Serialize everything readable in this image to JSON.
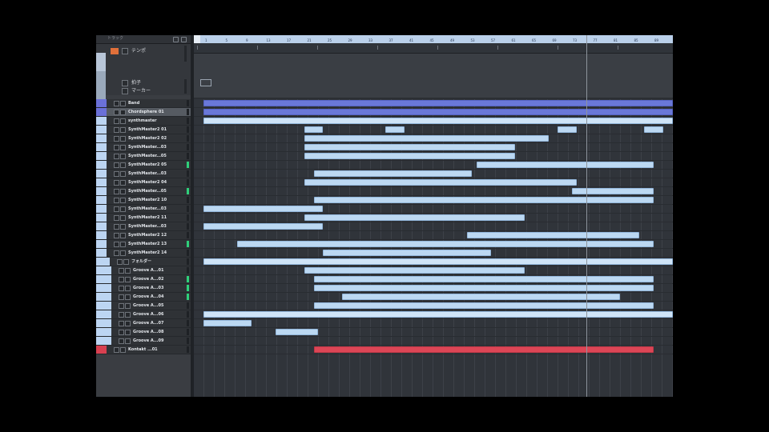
{
  "app": {
    "header_label": "トラック",
    "globals": [
      {
        "label": "テンポ"
      },
      {
        "label": "拍子"
      },
      {
        "label": "マーカー"
      }
    ]
  },
  "ruler": {
    "ticks": [
      "1",
      "5",
      "9",
      "13",
      "17",
      "21",
      "25",
      "29",
      "33",
      "37",
      "41",
      "45",
      "49",
      "53",
      "57",
      "61",
      "65",
      "69",
      "73",
      "77",
      "81",
      "85",
      "89",
      "93"
    ]
  },
  "tracks": [
    {
      "name": "Band",
      "color": "purple",
      "meter": false
    },
    {
      "name": "Chordsphere 01",
      "color": "purple",
      "meter": false,
      "selected": true
    },
    {
      "name": "synthmaster",
      "color": "lightb",
      "meter": false
    },
    {
      "name": "SynthMaster2 01",
      "color": "lightb",
      "meter": false
    },
    {
      "name": "SynthMaster2 02",
      "color": "lightb",
      "meter": false
    },
    {
      "name": "SynthMaster...03",
      "color": "lightb",
      "meter": false
    },
    {
      "name": "SynthMaster...05",
      "color": "lightb",
      "meter": false
    },
    {
      "name": "SynthMaster2 05",
      "color": "lightb",
      "meter": true
    },
    {
      "name": "SynthMaster...03",
      "color": "lightb",
      "meter": false
    },
    {
      "name": "SynthMaster2 04",
      "color": "lightb",
      "meter": false
    },
    {
      "name": "SynthMaster...05",
      "color": "lightb",
      "meter": true
    },
    {
      "name": "SynthMaster2 10",
      "color": "lightb",
      "meter": false
    },
    {
      "name": "SynthMaster...03",
      "color": "lightb",
      "meter": false
    },
    {
      "name": "SynthMaster2 11",
      "color": "lightb",
      "meter": false
    },
    {
      "name": "SynthMaster...03",
      "color": "lightb",
      "meter": false
    },
    {
      "name": "SynthMaster2 12",
      "color": "lightb",
      "meter": false
    },
    {
      "name": "SynthMaster2 13",
      "color": "lightb",
      "meter": true
    },
    {
      "name": "SynthMaster2 14",
      "color": "lightb",
      "meter": false
    },
    {
      "name": "フォルダー",
      "color": "lightb",
      "meter": false
    },
    {
      "name": "Groove A...01",
      "color": "lightb",
      "meter": false
    },
    {
      "name": "Groove A...02",
      "color": "lightb",
      "meter": true
    },
    {
      "name": "Groove A...03",
      "color": "lightb",
      "meter": true
    },
    {
      "name": "Groove A...04",
      "color": "lightb",
      "meter": true
    },
    {
      "name": "Groove A...05",
      "color": "lightb",
      "meter": false
    },
    {
      "name": "Groove A...06",
      "color": "lightb",
      "meter": false
    },
    {
      "name": "Groove A...07",
      "color": "lightb",
      "meter": false
    },
    {
      "name": "Groove A...08",
      "color": "lightb",
      "meter": false
    },
    {
      "name": "Groove A...09",
      "color": "lightb",
      "meter": false
    },
    {
      "name": "Kontakt ...01",
      "color": "red",
      "meter": false
    }
  ],
  "events": [
    {
      "row": 0,
      "from": 0.02,
      "to": 1.0,
      "style": "dark"
    },
    {
      "row": 1,
      "from": 0.02,
      "to": 1.0,
      "style": "dark"
    },
    {
      "row": 2,
      "from": 0.02,
      "to": 1.0,
      "style": "light"
    },
    {
      "row": 3,
      "from": 0.23,
      "to": 0.27,
      "style": "normal"
    },
    {
      "row": 3,
      "from": 0.4,
      "to": 0.44,
      "style": "normal"
    },
    {
      "row": 3,
      "from": 0.76,
      "to": 0.8,
      "style": "normal"
    },
    {
      "row": 3,
      "from": 0.94,
      "to": 0.98,
      "style": "normal"
    },
    {
      "row": 4,
      "from": 0.23,
      "to": 0.74,
      "style": "normal"
    },
    {
      "row": 5,
      "from": 0.23,
      "to": 0.67,
      "style": "normal"
    },
    {
      "row": 6,
      "from": 0.23,
      "to": 0.67,
      "style": "normal"
    },
    {
      "row": 7,
      "from": 0.59,
      "to": 0.96,
      "style": "normal"
    },
    {
      "row": 8,
      "from": 0.25,
      "to": 0.58,
      "style": "normal"
    },
    {
      "row": 9,
      "from": 0.23,
      "to": 0.8,
      "style": "normal"
    },
    {
      "row": 10,
      "from": 0.79,
      "to": 0.96,
      "style": "normal"
    },
    {
      "row": 11,
      "from": 0.25,
      "to": 0.96,
      "style": "normal"
    },
    {
      "row": 12,
      "from": 0.02,
      "to": 0.27,
      "style": "normal"
    },
    {
      "row": 13,
      "from": 0.23,
      "to": 0.69,
      "style": "normal"
    },
    {
      "row": 14,
      "from": 0.02,
      "to": 0.27,
      "style": "normal"
    },
    {
      "row": 15,
      "from": 0.57,
      "to": 0.93,
      "style": "normal"
    },
    {
      "row": 16,
      "from": 0.09,
      "to": 0.96,
      "style": "normal"
    },
    {
      "row": 17,
      "from": 0.27,
      "to": 0.62,
      "style": "normal"
    },
    {
      "row": 18,
      "from": 0.02,
      "to": 1.0,
      "style": "light"
    },
    {
      "row": 19,
      "from": 0.23,
      "to": 0.69,
      "style": "normal"
    },
    {
      "row": 20,
      "from": 0.25,
      "to": 0.96,
      "style": "normal"
    },
    {
      "row": 21,
      "from": 0.25,
      "to": 0.96,
      "style": "normal"
    },
    {
      "row": 22,
      "from": 0.31,
      "to": 0.89,
      "style": "normal"
    },
    {
      "row": 23,
      "from": 0.25,
      "to": 0.96,
      "style": "normal"
    },
    {
      "row": 24,
      "from": 0.02,
      "to": 1.0,
      "style": "light"
    },
    {
      "row": 25,
      "from": 0.02,
      "to": 0.12,
      "style": "normal"
    },
    {
      "row": 26,
      "from": 0.17,
      "to": 0.26,
      "style": "normal"
    },
    {
      "row": 28,
      "from": 0.25,
      "to": 0.96,
      "style": "red"
    }
  ]
}
